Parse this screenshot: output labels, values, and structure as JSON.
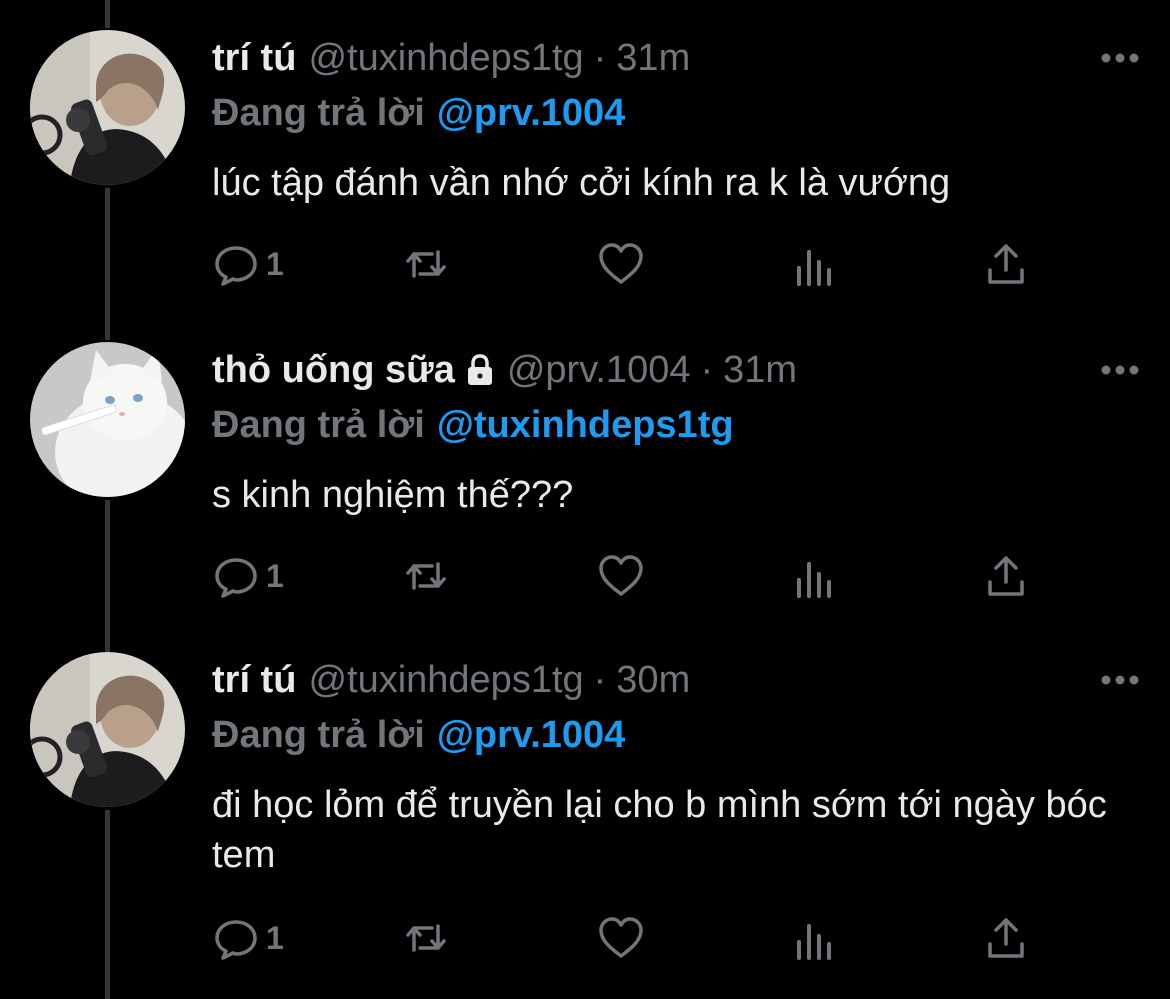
{
  "colors": {
    "background": "#000000",
    "primary_text": "#e7e9ea",
    "secondary_text": "#71767b",
    "accent": "#1d9bf0",
    "thread_line": "#333639"
  },
  "reply_prefix": "Đang trả lời",
  "tweets": [
    {
      "display_name": "trí tú",
      "handle": "@tuxinhdeps1tg",
      "separator": "·",
      "time": "31m",
      "reply_to": "@prv.1004",
      "text": "lúc tập đánh vần nhớ cởi kính ra k là vướng",
      "reply_count": "1",
      "locked": false,
      "avatar_icon": "avatar-person-photo"
    },
    {
      "display_name": "thỏ uống sữa",
      "handle": "@prv.1004",
      "separator": "·",
      "time": "31m",
      "reply_to": "@tuxinhdeps1tg",
      "text": "s kinh nghiệm thế???",
      "reply_count": "1",
      "locked": true,
      "avatar_icon": "avatar-white-cat"
    },
    {
      "display_name": "trí tú",
      "handle": "@tuxinhdeps1tg",
      "separator": "·",
      "time": "30m",
      "reply_to": "@prv.1004",
      "text": "đi học lỏm để truyền lại cho b mình sớm tới ngày bóc tem",
      "reply_count": "1",
      "locked": false,
      "avatar_icon": "avatar-person-photo"
    }
  ],
  "action_icons": [
    "reply-icon",
    "retweet-icon",
    "like-icon",
    "views-icon",
    "share-icon"
  ]
}
